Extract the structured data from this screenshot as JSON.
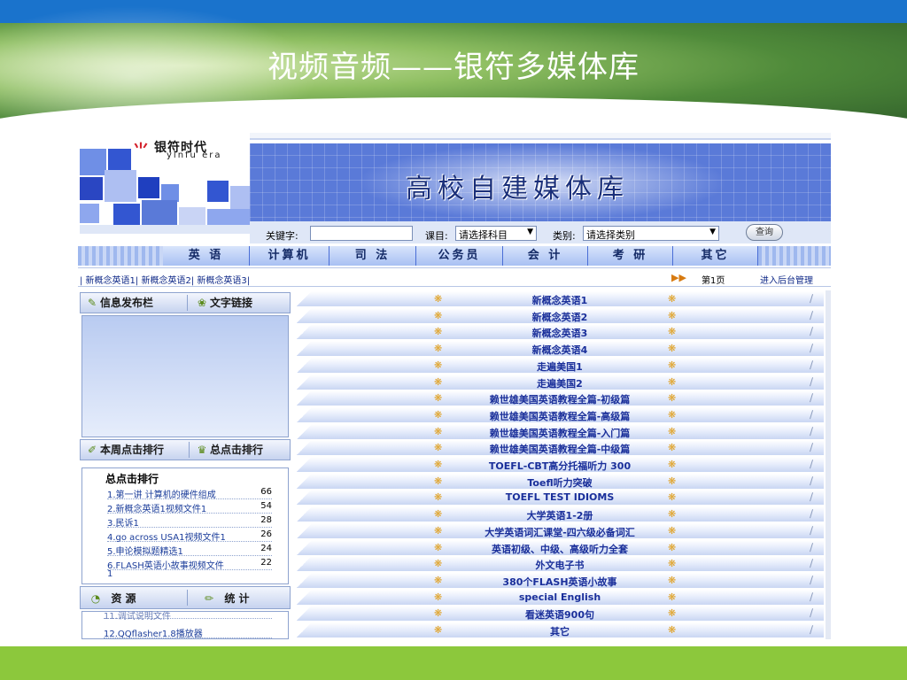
{
  "slide": {
    "title": "视频音频——银符多媒体库"
  },
  "site": {
    "logo_cn": "银符时代",
    "logo_en": "yinfu era",
    "banner_title": "高校自建媒体库"
  },
  "search": {
    "keyword_label": "关键字:",
    "keyword_value": "",
    "subject_label": "课目:",
    "subject_value": "请选择科目",
    "category_label": "类别:",
    "category_value": "请选择类别",
    "query_button": "查询"
  },
  "nav": {
    "items": [
      "英 语",
      "计算机",
      "司 法",
      "公务员",
      "会 计",
      "考 研",
      "其它"
    ]
  },
  "subnav": {
    "links": "| 新概念英语1| 新概念英语2| 新概念英语3|",
    "page": "第1页",
    "admin": "进入后台管理"
  },
  "left": {
    "tab_news": "信息发布栏",
    "tab_links": "文字链接",
    "tab_weekly": "本周点击排行",
    "tab_total": "总点击排行",
    "rank_title": "总点击排行",
    "rank": [
      {
        "title": "1.第一讲 计算机的硬件组成",
        "count": "66"
      },
      {
        "title": "2.新概念英语1视频文件1",
        "count": "54"
      },
      {
        "title": "3.民诉1",
        "count": "28"
      },
      {
        "title": "4.go across USA1视频文件1",
        "count": "26"
      },
      {
        "title": "5.申论模拟题精选1",
        "count": "24"
      },
      {
        "title": "6.FLASH英语小故事视频文件",
        "count": "22"
      }
    ],
    "rank_wrap": "1",
    "tab_res": "资 源",
    "tab_stat": "统 计",
    "res_items": [
      "11.调试说明文件",
      "12.QQflasher1.8播放器"
    ]
  },
  "list": {
    "items": [
      "新概念英语1",
      "新概念英语2",
      "新概念英语3",
      "新概念英语4",
      "走遍美国1",
      "走遍美国2",
      "赖世雄美国英语教程全篇-初级篇",
      "赖世雄美国英语教程全篇-高级篇",
      "赖世雄美国英语教程全篇-入门篇",
      "赖世雄美国英语教程全篇-中级篇",
      "TOEFL-CBT高分托福听力 300",
      "Toefl听力突破",
      "TOEFL TEST IDIOMS",
      "大学英语1-2册",
      "大学英语词汇课堂-四六级必备词汇",
      "英语初级、中级、高级听力全套",
      "外文电子书",
      "380个FLASH英语小故事",
      "special English",
      "看迷英语900句",
      "其它"
    ]
  },
  "colors": {
    "top_bar": "#1a73cc",
    "bottom_bar": "#8cc83c",
    "link_blue": "#1a2f9a"
  }
}
